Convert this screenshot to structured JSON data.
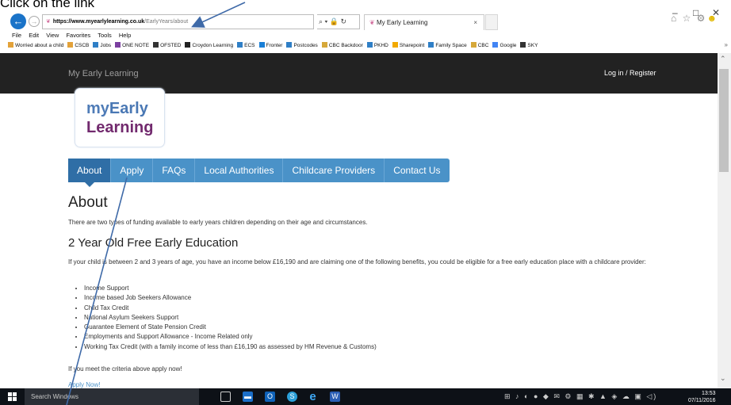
{
  "caption": "Click on the link",
  "window_controls": {
    "minimize": "–",
    "maximize": "□",
    "close": "✕"
  },
  "browser": {
    "url_domain": "https://www.myearlylearning.co.uk",
    "url_path": "/EarlyYears/about",
    "address_tools": "⌕ ▾ 🔒 ↻",
    "tab_title": "My Early Learning",
    "tab_close": "×",
    "toolbar_icons": "⌂ ☆ ⚙",
    "toolbar_smile": "☻"
  },
  "menu": [
    "File",
    "Edit",
    "View",
    "Favorites",
    "Tools",
    "Help"
  ],
  "favorites": [
    {
      "label": "Worried about a child",
      "color": "#e3a23a"
    },
    {
      "label": "CSCB",
      "color": "#e3a23a"
    },
    {
      "label": "Jobs",
      "color": "#2f7fc6"
    },
    {
      "label": "ONE NOTE",
      "color": "#7b3fa0"
    },
    {
      "label": "OFSTED",
      "color": "#333333"
    },
    {
      "label": "Croydon Learning",
      "color": "#222222"
    },
    {
      "label": "ECS",
      "color": "#2f7fc6"
    },
    {
      "label": "Fronter",
      "color": "#1a7fd6"
    },
    {
      "label": "Postcodes",
      "color": "#2f7fc6"
    },
    {
      "label": "CBC Backdoor",
      "color": "#d6a83a"
    },
    {
      "label": "PKHD",
      "color": "#2f7fc6"
    },
    {
      "label": "Sharepoint",
      "color": "#f2a900"
    },
    {
      "label": "Family Space",
      "color": "#2f7fc6"
    },
    {
      "label": "CBC",
      "color": "#d6a83a"
    },
    {
      "label": "Google",
      "color": "#4285f4"
    },
    {
      "label": "SKY",
      "color": "#333333"
    }
  ],
  "favorites_more": "»",
  "site": {
    "brand": "My Early Learning",
    "login": "Log in / Register",
    "logo_my": "my",
    "logo_early": "Early",
    "logo_learning": "Learning",
    "tabs": [
      "About",
      "Apply",
      "FAQs",
      "Local Authorities",
      "Childcare Providers",
      "Contact Us"
    ],
    "heading": "About",
    "intro": "There are two types of funding available to early years children depending on their age and circumstances.",
    "subheading": "2 Year Old Free Early Education",
    "paragraph": "If your child is between 2 and 3 years of age, you have an income below £16,190 and are claiming one of the following benefits, you could be eligible for a free early education place with a childcare provider:",
    "benefits": [
      "Income Support",
      "Income based Job Seekers Allowance",
      "Child Tax Credit",
      "National Asylum Seekers Support",
      "Guarantee Element of State Pension Credit",
      "Employments and Support Allowance - Income Related only",
      "Working Tax Credit (with a family income of less than £16,190 as assessed by HM Revenue & Customs)"
    ],
    "cta": "If you meet the criteria above apply now!",
    "apply_link": "Apply Now!"
  },
  "taskbar": {
    "search_placeholder": "Search Windows",
    "tray_icons": "⊞ ♪ ◐ ● ◆ ✉ ⚙ ▦ ✱ ▲ ◈ ☁ ▣ ◁)",
    "time": "13:53",
    "date": "07/11/2016"
  },
  "colors": {
    "nav_bg": "#222222",
    "tab_blue": "#4a92c8",
    "tab_active": "#2f6ea6",
    "logo_blue": "#4f7cb7",
    "logo_purple": "#722a6e",
    "arrow": "#3f6aa8"
  }
}
